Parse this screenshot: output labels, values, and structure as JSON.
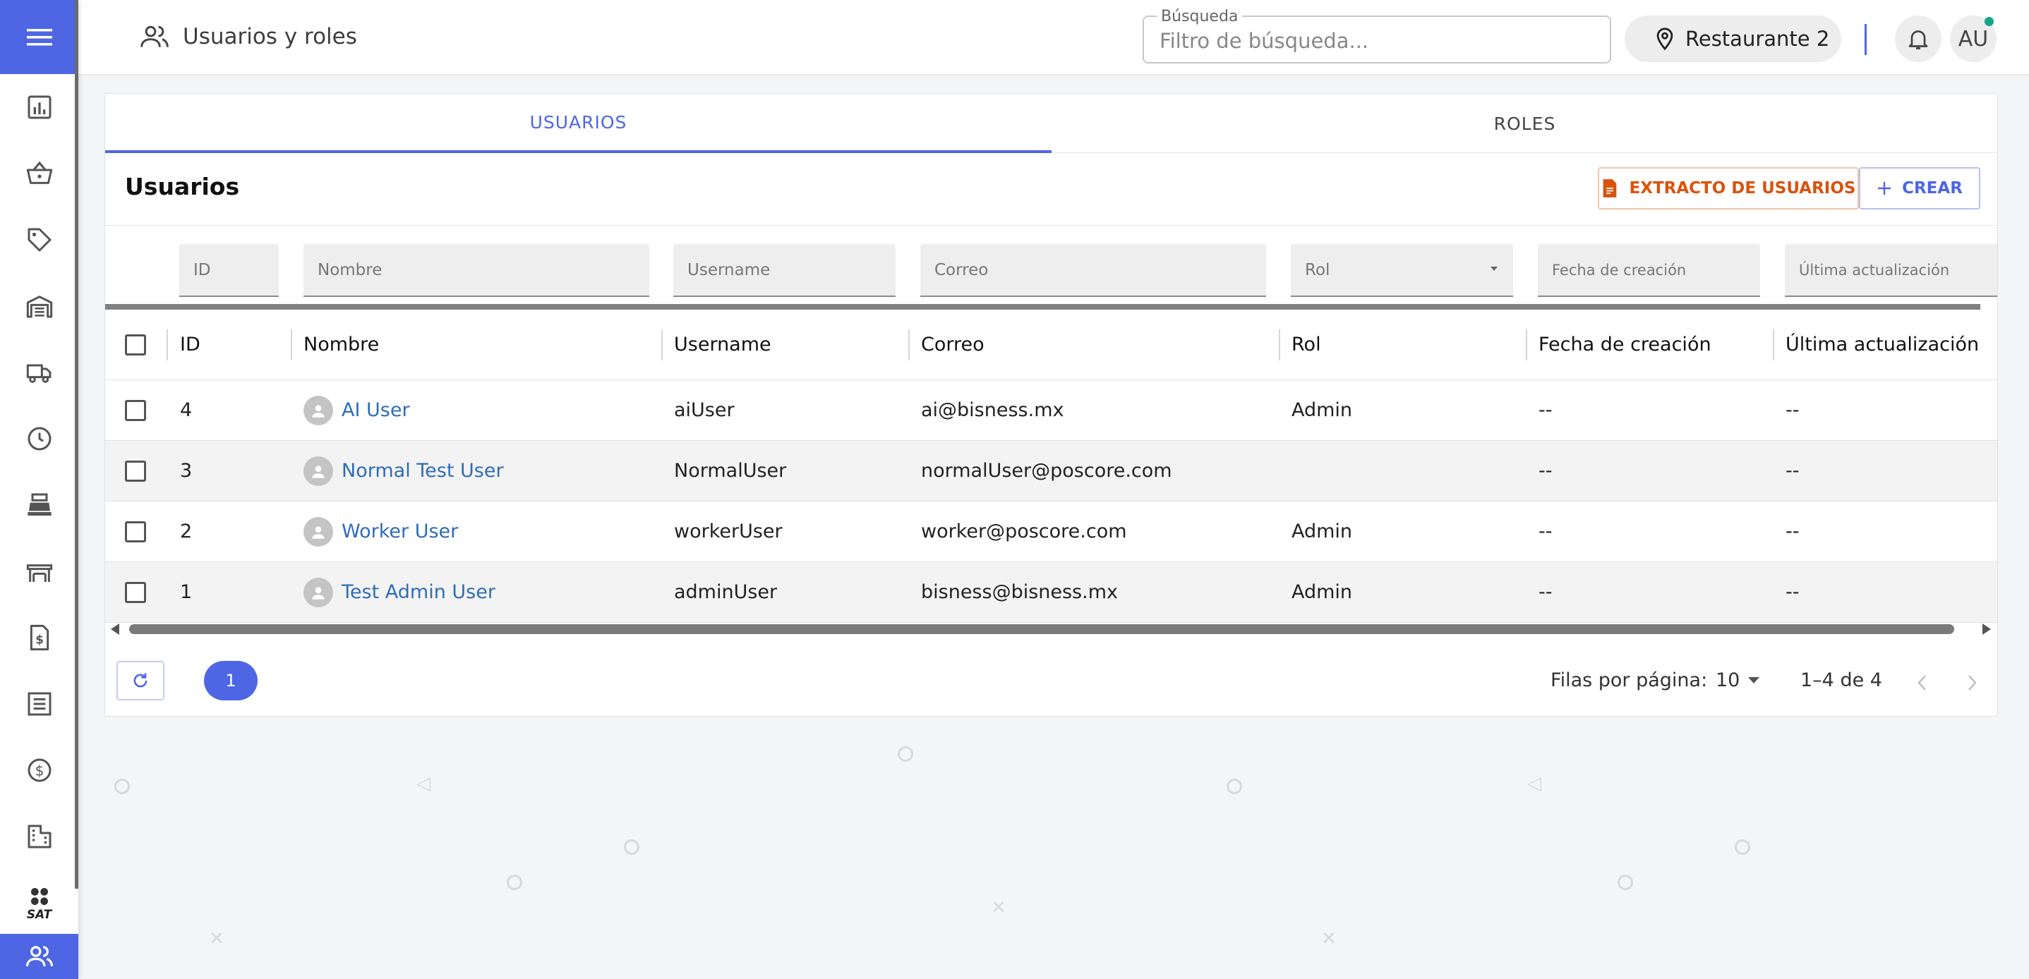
{
  "header": {
    "title": "Usuarios y roles",
    "search_label": "Búsqueda",
    "search_placeholder": "Filtro de búsqueda...",
    "location": "Restaurante 2",
    "avatar_initials": "AU"
  },
  "sidebar": {
    "items": [
      {
        "icon": "bar-chart-icon"
      },
      {
        "icon": "basket-icon"
      },
      {
        "icon": "tag-icon"
      },
      {
        "icon": "warehouse-icon"
      },
      {
        "icon": "truck-icon"
      },
      {
        "icon": "clock-icon"
      },
      {
        "icon": "cash-register-icon"
      },
      {
        "icon": "table-icon"
      },
      {
        "icon": "invoice-dollar-icon"
      },
      {
        "icon": "list-icon"
      },
      {
        "icon": "dollar-circle-icon"
      },
      {
        "icon": "building-icon"
      },
      {
        "icon": "sat-icon",
        "label": "SAT"
      },
      {
        "icon": "users-icon",
        "active": true
      }
    ]
  },
  "tabs": [
    {
      "label": "USUARIOS",
      "active": true
    },
    {
      "label": "ROLES",
      "active": false
    }
  ],
  "section": {
    "title": "Usuarios",
    "extract_button": "EXTRACTO DE USUARIOS",
    "create_button": "CREAR"
  },
  "filters": {
    "id": "ID",
    "nombre": "Nombre",
    "username": "Username",
    "correo": "Correo",
    "rol": "Rol",
    "fecha_creacion": "Fecha de creación",
    "ultima_actualizacion": "Última actualización"
  },
  "table": {
    "columns": [
      "ID",
      "Nombre",
      "Username",
      "Correo",
      "Rol",
      "Fecha de creación",
      "Última actualización"
    ],
    "rows": [
      {
        "id": "4",
        "nombre": "AI User",
        "username": "aiUser",
        "correo": "ai@bisness.mx",
        "rol": "Admin",
        "creado": "--",
        "actualizado": "--"
      },
      {
        "id": "3",
        "nombre": "Normal Test User",
        "username": "NormalUser",
        "correo": "normalUser@poscore.com",
        "rol": "",
        "creado": "--",
        "actualizado": "--"
      },
      {
        "id": "2",
        "nombre": "Worker User",
        "username": "workerUser",
        "correo": "worker@poscore.com",
        "rol": "Admin",
        "creado": "--",
        "actualizado": "--"
      },
      {
        "id": "1",
        "nombre": "Test Admin User",
        "username": "adminUser",
        "correo": "bisness@bisness.mx",
        "rol": "Admin",
        "creado": "--",
        "actualizado": "--"
      }
    ]
  },
  "pagination": {
    "current_page": "1",
    "rows_label": "Filas por página:",
    "rows_per_page": "10",
    "range": "1–4 de 4"
  },
  "colors": {
    "accent": "#4e66e4",
    "extract": "#d9530d",
    "link": "#2f6db5",
    "notification_dot": "#13a58a"
  }
}
